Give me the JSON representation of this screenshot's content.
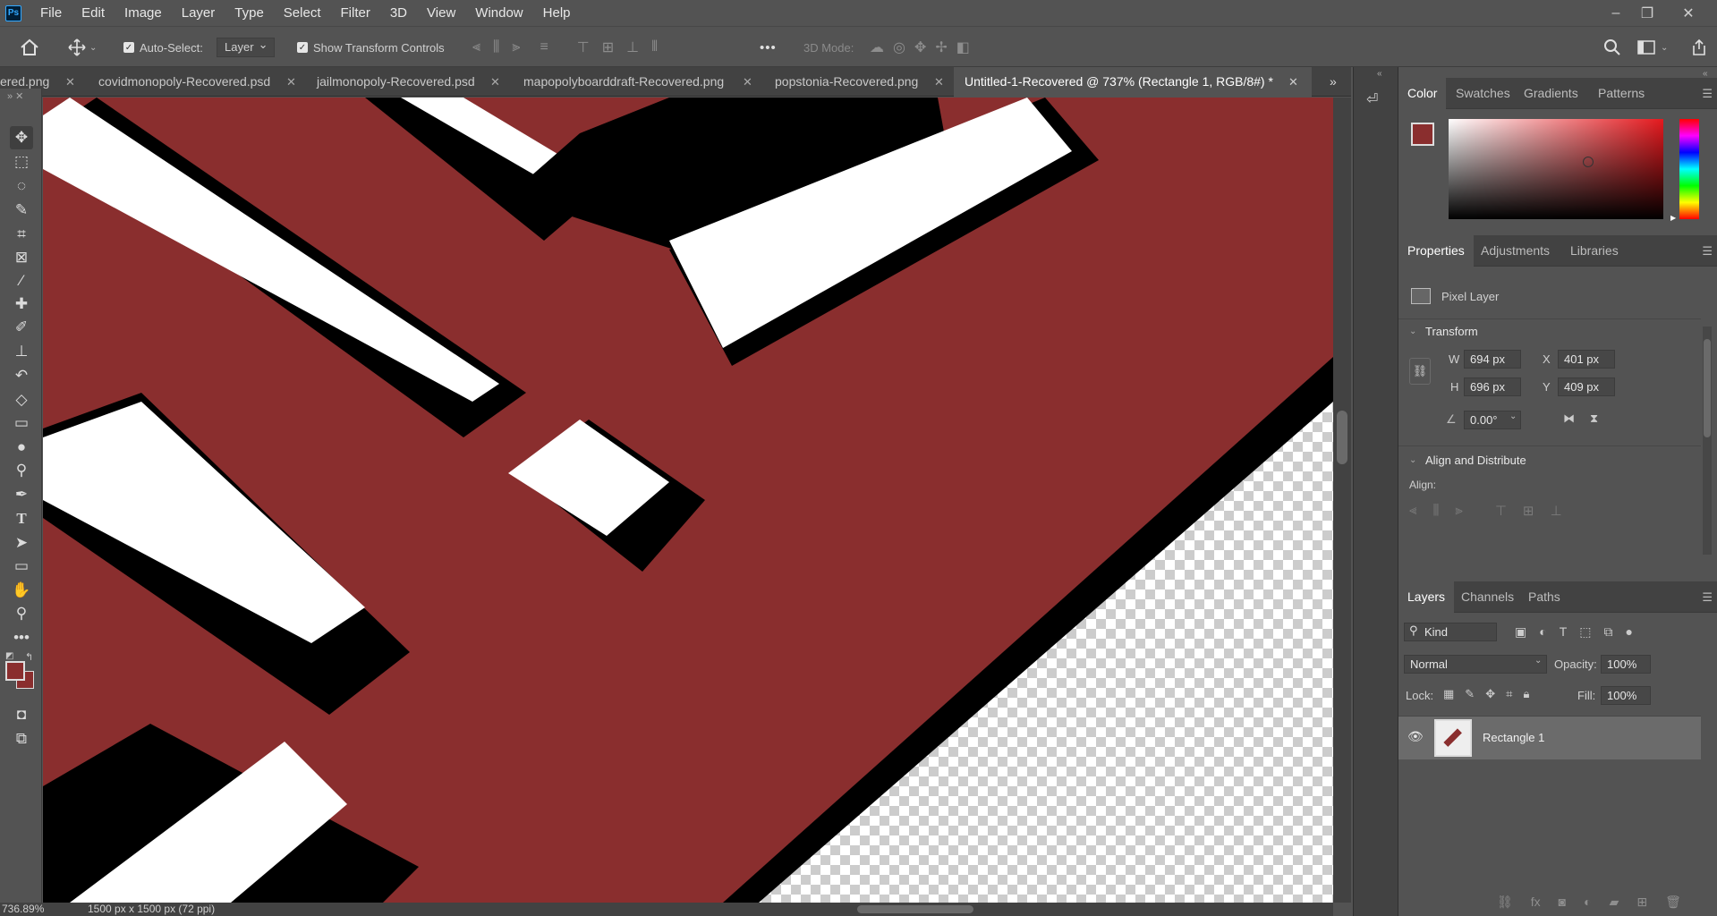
{
  "app": {
    "logo": "Ps"
  },
  "menu": [
    "File",
    "Edit",
    "Image",
    "Layer",
    "Type",
    "Select",
    "Filter",
    "3D",
    "View",
    "Window",
    "Help"
  ],
  "window_controls": {
    "minimize": "–",
    "restore": "❐",
    "close": "✕"
  },
  "options_bar": {
    "auto_select_label": "Auto-Select:",
    "auto_select_value": "Layer",
    "show_transform_label": "Show Transform Controls",
    "mode_3d_label": "3D Mode:",
    "more": "•••"
  },
  "tabs": [
    {
      "label": "ered.png",
      "active": false
    },
    {
      "label": "covidmonopoly-Recovered.psd",
      "active": false
    },
    {
      "label": "jailmonopoly-Recovered.psd",
      "active": false
    },
    {
      "label": "mapopolyboarddraft-Recovered.png",
      "active": false
    },
    {
      "label": "popstonia-Recovered.png",
      "active": false
    },
    {
      "label": "Untitled-1-Recovered @ 737% (Rectangle 1, RGB/8#) *",
      "active": true
    }
  ],
  "status": {
    "zoom": "736.89%",
    "doc_info": "1500 px x 1500 px (72 ppi)"
  },
  "colors": {
    "foreground": "#8a2e2e",
    "background": "#8a2e2e",
    "canvas_red": "#8a2e2e"
  },
  "color_panel": {
    "tabs": [
      "Color",
      "Swatches",
      "Gradients",
      "Patterns"
    ]
  },
  "properties_panel": {
    "tabs": [
      "Properties",
      "Adjustments",
      "Libraries"
    ],
    "layer_type": "Pixel Layer",
    "transform_title": "Transform",
    "w_label": "W",
    "w_value": "694 px",
    "x_label": "X",
    "x_value": "401 px",
    "h_label": "H",
    "h_value": "696 px",
    "y_label": "Y",
    "y_value": "409 px",
    "angle_value": "0.00°",
    "align_title": "Align and Distribute",
    "align_label": "Align:"
  },
  "layers_panel": {
    "tabs": [
      "Layers",
      "Channels",
      "Paths"
    ],
    "filter_kind": "Kind",
    "blend_mode": "Normal",
    "opacity_label": "Opacity:",
    "opacity_value": "100%",
    "lock_label": "Lock:",
    "fill_label": "Fill:",
    "fill_value": "100%",
    "layer_name": "Rectangle 1"
  }
}
